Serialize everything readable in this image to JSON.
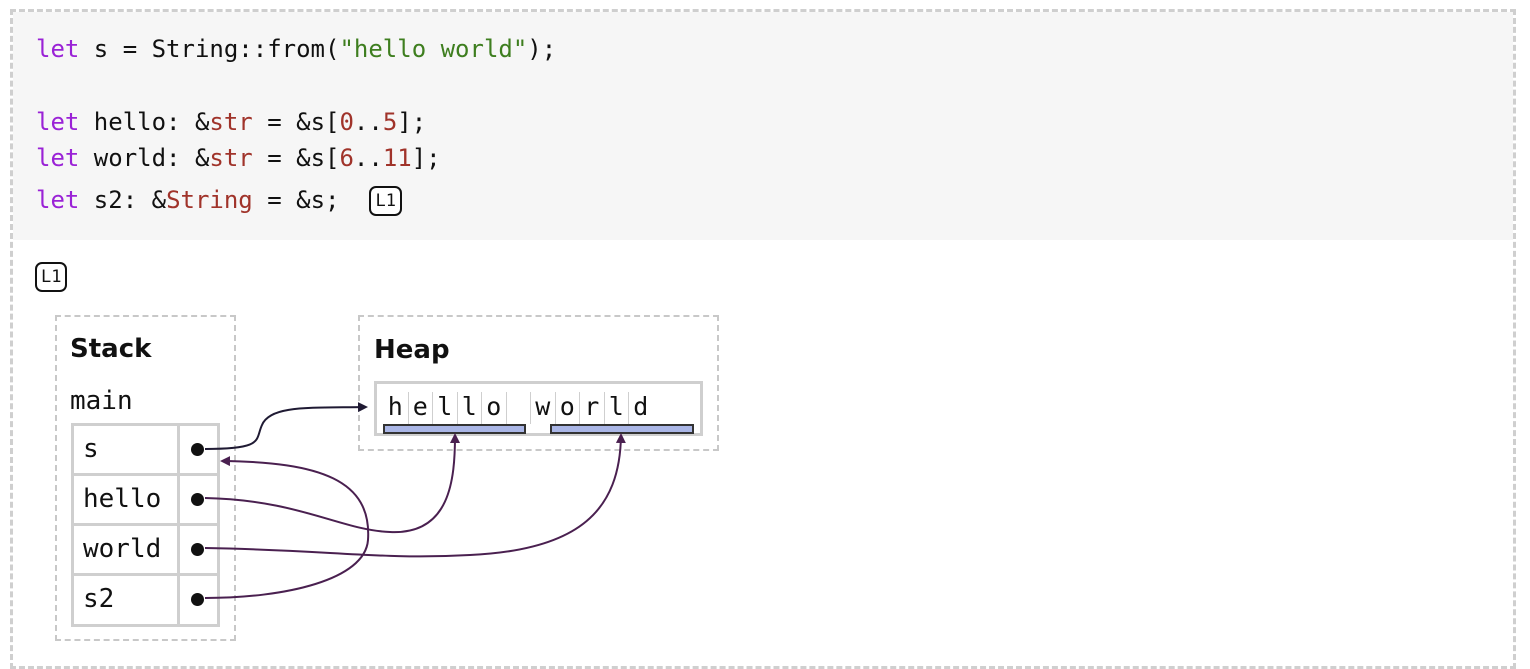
{
  "code": {
    "line1": {
      "kw": "let",
      "pre": " s = String::from(",
      "str": "\"hello world\"",
      "post": ");"
    },
    "line2": {
      "kw": "let",
      "pre": " hello: &",
      "ty": "str",
      "mid": " = &s[",
      "n1": "0",
      "dots": "..",
      "n2": "5",
      "post": "];"
    },
    "line3": {
      "kw": "let",
      "pre": " world: &",
      "ty": "str",
      "mid": " = &s[",
      "n1": "6",
      "dots": "..",
      "n2": "11",
      "post": "];"
    },
    "line4": {
      "kw": "let",
      "pre": " s2: &",
      "ty": "String",
      "mid": " = &s;",
      "badge": "L1"
    }
  },
  "diagram": {
    "badge": "L1",
    "stack_title": "Stack",
    "frame_name": "main",
    "stack_vars": [
      "s",
      "hello",
      "world",
      "s2"
    ],
    "heap_title": "Heap",
    "heap_chars": [
      "h",
      "e",
      "l",
      "l",
      "o",
      " ",
      "w",
      "o",
      "r",
      "l",
      "d"
    ]
  },
  "colors": {
    "keyword": "#9a22d6",
    "string": "#3e7e1f",
    "number": "#a0332a",
    "type": "#a0332a",
    "arrow_owner": "#1f1a33",
    "arrow_ref": "#4a2050",
    "highlight": "#aab6e6"
  }
}
